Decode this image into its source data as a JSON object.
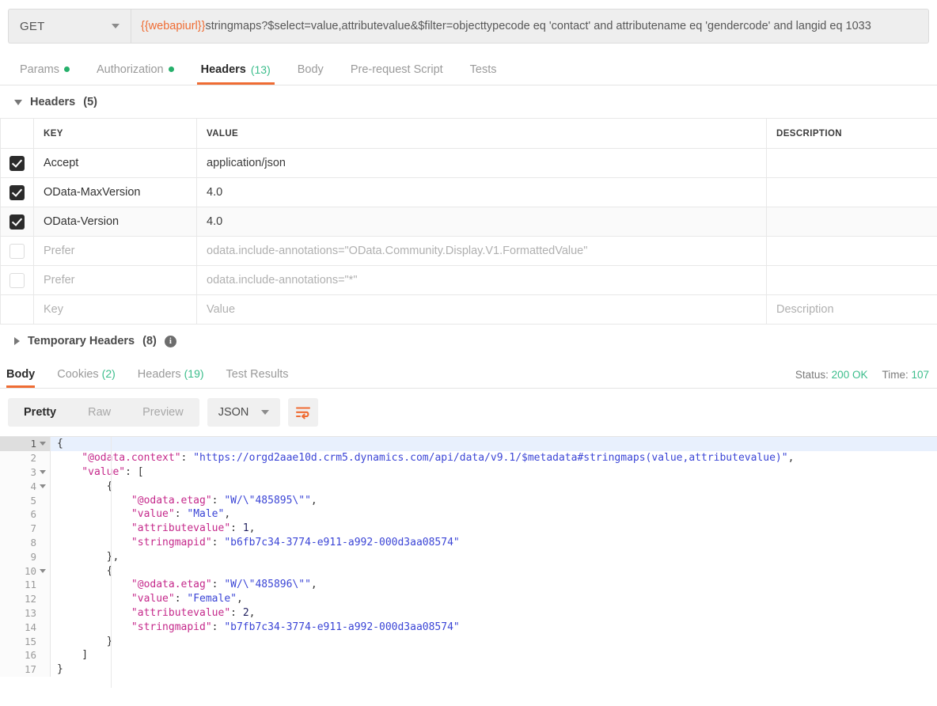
{
  "request": {
    "method": "GET",
    "url_variable": "{{webapiurl}}",
    "url_rest": "stringmaps?$select=value,attributevalue&$filter=objecttypecode eq 'contact' and attributename eq 'gendercode' and langid eq 1033",
    "tabs": [
      {
        "label": "Params",
        "dot": true,
        "count": "",
        "active": false
      },
      {
        "label": "Authorization",
        "dot": true,
        "count": "",
        "active": false
      },
      {
        "label": "Headers",
        "dot": false,
        "count": "(13)",
        "active": true
      },
      {
        "label": "Body",
        "dot": false,
        "count": "",
        "active": false
      },
      {
        "label": "Pre-request Script",
        "dot": false,
        "count": "",
        "active": false
      },
      {
        "label": "Tests",
        "dot": false,
        "count": "",
        "active": false
      }
    ]
  },
  "headers_section": {
    "title": "Headers",
    "count": "(5)",
    "columns": {
      "key": "KEY",
      "value": "VALUE",
      "description": "DESCRIPTION"
    },
    "rows": [
      {
        "checked": true,
        "key": "Accept",
        "value": "application/json",
        "description": "",
        "placeholder": false
      },
      {
        "checked": true,
        "key": "OData-MaxVersion",
        "value": "4.0",
        "description": "",
        "placeholder": false
      },
      {
        "checked": true,
        "key": "OData-Version",
        "value": "4.0",
        "description": "",
        "placeholder": false
      },
      {
        "checked": false,
        "key": "Prefer",
        "value": "odata.include-annotations=\"OData.Community.Display.V1.FormattedValue\"",
        "description": "",
        "placeholder": false
      },
      {
        "checked": false,
        "key": "Prefer",
        "value": "odata.include-annotations=\"*\"",
        "description": "",
        "placeholder": false
      },
      {
        "checked": false,
        "key": "Key",
        "value": "Value",
        "description": "Description",
        "placeholder": true
      }
    ]
  },
  "temp_headers": {
    "title": "Temporary Headers",
    "count": "(8)",
    "info_glyph": "i"
  },
  "response": {
    "tabs": [
      {
        "label": "Body",
        "count": "",
        "active": true
      },
      {
        "label": "Cookies",
        "count": "(2)",
        "active": false
      },
      {
        "label": "Headers",
        "count": "(19)",
        "active": false
      },
      {
        "label": "Test Results",
        "count": "",
        "active": false
      }
    ],
    "status_label": "Status:",
    "status_value": "200 OK",
    "time_label": "Time:",
    "time_value": "107",
    "view_modes": [
      {
        "label": "Pretty",
        "active": true
      },
      {
        "label": "Raw",
        "active": false
      },
      {
        "label": "Preview",
        "active": false
      }
    ],
    "format": "JSON",
    "accent_color": "#ef6c33"
  },
  "body_code": [
    {
      "num": "1",
      "fold": true,
      "hl": true,
      "tokens": [
        {
          "t": "{",
          "c": "p"
        }
      ]
    },
    {
      "num": "2",
      "fold": false,
      "hl": false,
      "tokens": [
        {
          "t": "    \"@odata.context\"",
          "c": "k"
        },
        {
          "t": ": ",
          "c": "p"
        },
        {
          "t": "\"https://orgd2aae10d.crm5.dynamics.com/api/data/v9.1/$metadata#stringmaps(value,attributevalue)\"",
          "c": "s"
        },
        {
          "t": ",",
          "c": "p"
        }
      ]
    },
    {
      "num": "3",
      "fold": true,
      "hl": false,
      "tokens": [
        {
          "t": "    \"value\"",
          "c": "k"
        },
        {
          "t": ": [",
          "c": "p"
        }
      ]
    },
    {
      "num": "4",
      "fold": true,
      "hl": false,
      "tokens": [
        {
          "t": "        {",
          "c": "p"
        }
      ]
    },
    {
      "num": "5",
      "fold": false,
      "hl": false,
      "tokens": [
        {
          "t": "            \"@odata.etag\"",
          "c": "k"
        },
        {
          "t": ": ",
          "c": "p"
        },
        {
          "t": "\"W/\\\"485895\\\"\"",
          "c": "s"
        },
        {
          "t": ",",
          "c": "p"
        }
      ]
    },
    {
      "num": "6",
      "fold": false,
      "hl": false,
      "tokens": [
        {
          "t": "            \"value\"",
          "c": "k"
        },
        {
          "t": ": ",
          "c": "p"
        },
        {
          "t": "\"Male\"",
          "c": "s"
        },
        {
          "t": ",",
          "c": "p"
        }
      ]
    },
    {
      "num": "7",
      "fold": false,
      "hl": false,
      "tokens": [
        {
          "t": "            \"attributevalue\"",
          "c": "k"
        },
        {
          "t": ": ",
          "c": "p"
        },
        {
          "t": "1",
          "c": "n"
        },
        {
          "t": ",",
          "c": "p"
        }
      ]
    },
    {
      "num": "8",
      "fold": false,
      "hl": false,
      "tokens": [
        {
          "t": "            \"stringmapid\"",
          "c": "k"
        },
        {
          "t": ": ",
          "c": "p"
        },
        {
          "t": "\"b6fb7c34-3774-e911-a992-000d3aa08574\"",
          "c": "s"
        }
      ]
    },
    {
      "num": "9",
      "fold": false,
      "hl": false,
      "tokens": [
        {
          "t": "        },",
          "c": "p"
        }
      ]
    },
    {
      "num": "10",
      "fold": true,
      "hl": false,
      "tokens": [
        {
          "t": "        {",
          "c": "p"
        }
      ]
    },
    {
      "num": "11",
      "fold": false,
      "hl": false,
      "tokens": [
        {
          "t": "            \"@odata.etag\"",
          "c": "k"
        },
        {
          "t": ": ",
          "c": "p"
        },
        {
          "t": "\"W/\\\"485896\\\"\"",
          "c": "s"
        },
        {
          "t": ",",
          "c": "p"
        }
      ]
    },
    {
      "num": "12",
      "fold": false,
      "hl": false,
      "tokens": [
        {
          "t": "            \"value\"",
          "c": "k"
        },
        {
          "t": ": ",
          "c": "p"
        },
        {
          "t": "\"Female\"",
          "c": "s"
        },
        {
          "t": ",",
          "c": "p"
        }
      ]
    },
    {
      "num": "13",
      "fold": false,
      "hl": false,
      "tokens": [
        {
          "t": "            \"attributevalue\"",
          "c": "k"
        },
        {
          "t": ": ",
          "c": "p"
        },
        {
          "t": "2",
          "c": "n"
        },
        {
          "t": ",",
          "c": "p"
        }
      ]
    },
    {
      "num": "14",
      "fold": false,
      "hl": false,
      "tokens": [
        {
          "t": "            \"stringmapid\"",
          "c": "k"
        },
        {
          "t": ": ",
          "c": "p"
        },
        {
          "t": "\"b7fb7c34-3774-e911-a992-000d3aa08574\"",
          "c": "s"
        }
      ]
    },
    {
      "num": "15",
      "fold": false,
      "hl": false,
      "tokens": [
        {
          "t": "        }",
          "c": "p"
        }
      ]
    },
    {
      "num": "16",
      "fold": false,
      "hl": false,
      "tokens": [
        {
          "t": "    ]",
          "c": "p"
        }
      ]
    },
    {
      "num": "17",
      "fold": false,
      "hl": false,
      "tokens": [
        {
          "t": "}",
          "c": "p"
        }
      ]
    }
  ]
}
